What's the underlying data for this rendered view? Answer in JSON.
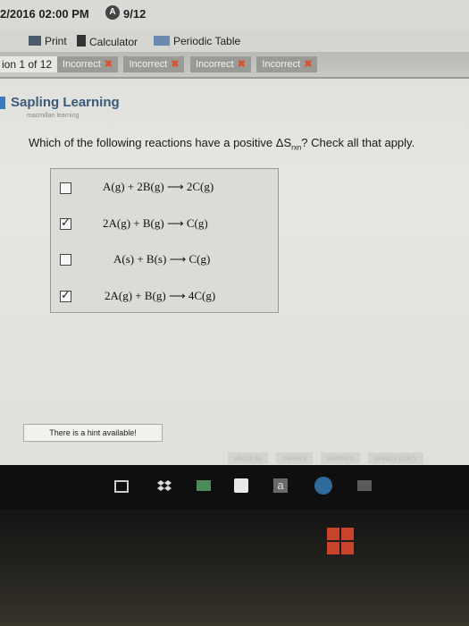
{
  "header": {
    "datetime": "2/2016 02:00 PM",
    "score_icon": "clock-check-icon",
    "score": "9/12"
  },
  "toolbar": {
    "print": "Print",
    "calculator": "Calculator",
    "periodic_table": "Periodic Table"
  },
  "question_nav": {
    "label": "ion 1 of 12",
    "attempts": [
      "Incorrect",
      "Incorrect",
      "Incorrect",
      "Incorrect"
    ]
  },
  "brand": {
    "name": "Sapling Learning",
    "sub": "macmillan learning"
  },
  "question": {
    "prefix": "Which of the following reactions have a positive ΔS",
    "subscript": "rxn",
    "suffix": "? Check all that apply."
  },
  "options": [
    {
      "reaction": "A(g) + 2B(g) ⟶ 2C(g)",
      "checked": false
    },
    {
      "reaction": "2A(g) + B(g) ⟶ C(g)",
      "checked": true
    },
    {
      "reaction": "A(s) + B(s) ⟶ C(g)",
      "checked": false
    },
    {
      "reaction": "2A(g) + B(g) ⟶ 4C(g)",
      "checked": true
    }
  ],
  "hint": "There is a hint available!",
  "footer_links": [
    "about us",
    "careers",
    "partners",
    "privacy policy"
  ],
  "taskbar": {
    "icons": [
      "task-view-icon",
      "dropbox-icon",
      "desktop-icon",
      "store-icon",
      "amazon-icon",
      "ie-icon",
      "media-icon"
    ]
  },
  "colors": {
    "incorrect_x": "#d9532e",
    "brand_blue": "#3b5a7a",
    "windows_logo": "#c8432a"
  }
}
